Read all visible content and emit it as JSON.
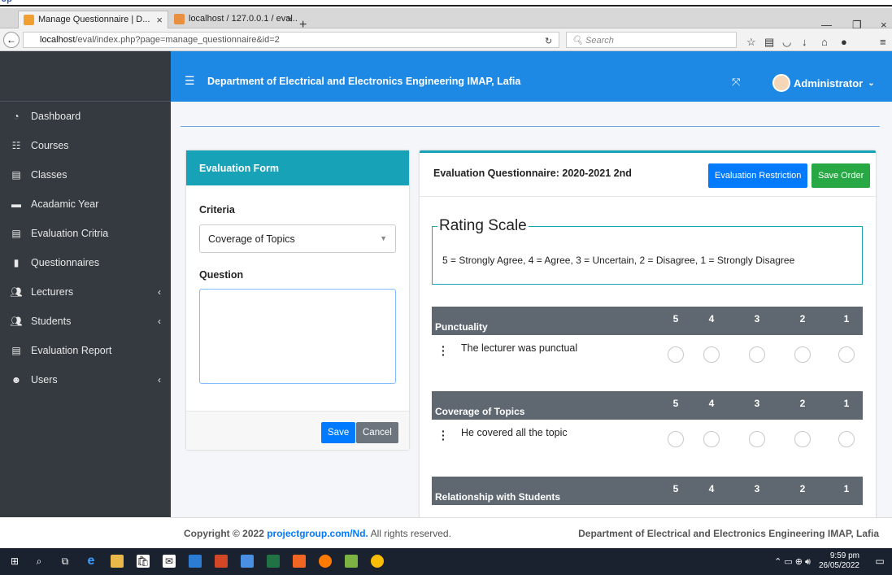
{
  "page_header_fragment": "Jp",
  "browser": {
    "tabs": [
      {
        "label": "Manage Questionnaire | D...",
        "active": true
      },
      {
        "label": "localhost / 127.0.0.1 / eval...",
        "active": false
      }
    ],
    "url_host": "localhost",
    "url_path": "/eval/index.php?page=manage_questionnaire&id=2",
    "search_placeholder": "Search"
  },
  "app": {
    "header_title": "Department of Electrical and Electronics Engineering IMAP, Lafia",
    "user_name": "Administrator",
    "accent": "#1e88e5",
    "sidebar_bg": "#343a40"
  },
  "sidebar": {
    "items": [
      {
        "label": "Dashboard",
        "icon": "dashboard-icon",
        "has_children": false
      },
      {
        "label": "Courses",
        "icon": "table-list-icon",
        "has_children": false
      },
      {
        "label": "Classes",
        "icon": "list-box-icon",
        "has_children": false
      },
      {
        "label": "Acadamic Year",
        "icon": "calendar-icon",
        "has_children": false
      },
      {
        "label": "Evaluation Critria",
        "icon": "list-box-icon",
        "has_children": false
      },
      {
        "label": "Questionnaires",
        "icon": "file-icon",
        "has_children": false
      },
      {
        "label": "Lecturers",
        "icon": "users-icon",
        "has_children": true
      },
      {
        "label": "Students",
        "icon": "users-icon",
        "has_children": true
      },
      {
        "label": "Evaluation Report",
        "icon": "list-box-icon",
        "has_children": false
      },
      {
        "label": "Users",
        "icon": "user-group-icon",
        "has_children": true
      }
    ]
  },
  "form": {
    "title": "Evaluation Form",
    "criteria_label": "Criteria",
    "criteria_value": "Coverage of Topics",
    "question_label": "Question",
    "question_value": "",
    "save_label": "Save",
    "cancel_label": "Cancel"
  },
  "questionnaire": {
    "title": "Evaluation Questionnaire: 2020-2021 2nd",
    "restriction_label": "Evaluation Restriction",
    "save_order_label": "Save Order",
    "rating_legend": "Rating Scale",
    "rating_text": "5 = Strongly Agree, 4 = Agree, 3 = Uncertain, 2 = Disagree, 1 = Strongly Disagree",
    "scale": [
      "5",
      "4",
      "3",
      "2",
      "1"
    ],
    "sections": [
      {
        "name": "Punctuality",
        "question": "The lecturer was punctual"
      },
      {
        "name": "Coverage of Topics",
        "question": "He covered all the topic"
      },
      {
        "name": "Relationship with Students",
        "question": ""
      }
    ]
  },
  "footer": {
    "copyright_prefix": "Copyright © 2022",
    "copyright_link": "projectgroup.com/Nd.",
    "copyright_suffix": "All rights reserved.",
    "right_text": "Department of Electrical and Electronics Engineering IMAP, Lafia"
  },
  "taskbar": {
    "time": "9:59 pm",
    "date": "26/05/2022"
  }
}
